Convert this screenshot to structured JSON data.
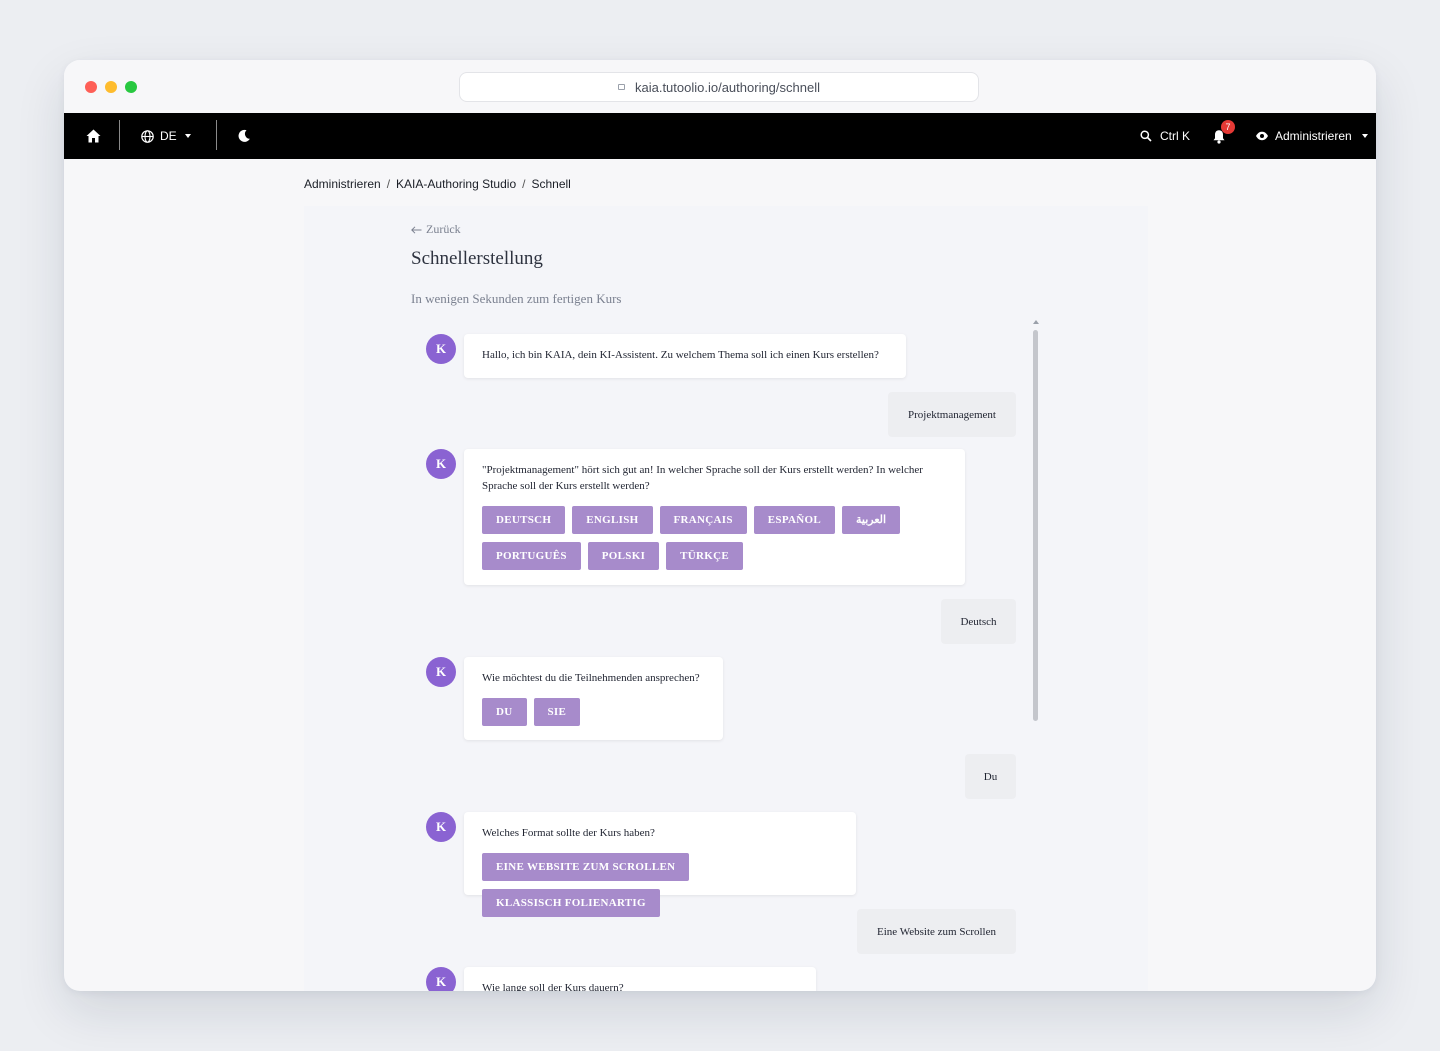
{
  "browser": {
    "url": "kaia.tutoolio.io/authoring/schnell"
  },
  "nav": {
    "language": "DE",
    "search_shortcut": "Ctrl K",
    "notification_count": "7",
    "role": "Administrieren"
  },
  "breadcrumb": [
    "Administrieren",
    "KAIA-Authoring Studio",
    "Schnell"
  ],
  "page": {
    "back": "Zurück",
    "title": "Schnellerstellung",
    "subtitle": "In wenigen Sekunden zum fertigen Kurs"
  },
  "chat": {
    "avatar_letter": "K",
    "bot": [
      {
        "text": "Hallo, ich bin KAIA, dein KI-Assistent. Zu welchem Thema soll ich einen Kurs erstellen?",
        "options": []
      },
      {
        "text": "\"Projektmanagement\" hört sich gut an! In welcher Sprache soll der Kurs erstellt werden? In welcher Sprache soll der Kurs erstellt werden?",
        "options": [
          "DEUTSCH",
          "ENGLISH",
          "FRANÇAIS",
          "ESPAÑOL",
          "العربية",
          "PORTUGUÊS",
          "POLSKI",
          "TÜRKÇE"
        ]
      },
      {
        "text": "Wie möchtest du die Teilnehmenden ansprechen?",
        "options": [
          "DU",
          "SIE"
        ]
      },
      {
        "text": "Welches Format sollte der Kurs haben?",
        "options": [
          "EINE WEBSITE ZUM SCROLLEN",
          "KLASSISCH FOLIENARTIG"
        ]
      },
      {
        "text": "Wie lange soll der Kurs dauern?",
        "options": []
      }
    ],
    "user": [
      "Projektmanagement",
      "Deutsch",
      "Du",
      "Eine Website zum Scrollen"
    ]
  }
}
